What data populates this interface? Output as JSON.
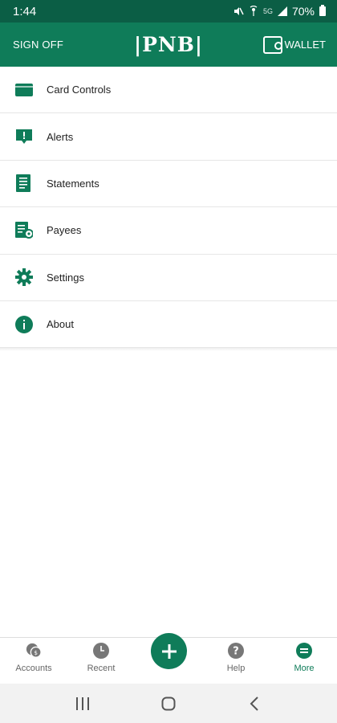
{
  "status_bar": {
    "time": "1:44",
    "network": "5G",
    "battery": "70%"
  },
  "header": {
    "sign_off": "SIGN OFF",
    "logo": "|PNB|",
    "wallet": "WALLET"
  },
  "menu": {
    "items": [
      {
        "label": "Card Controls",
        "icon": "card-icon"
      },
      {
        "label": "Alerts",
        "icon": "alert-icon"
      },
      {
        "label": "Statements",
        "icon": "statement-icon"
      },
      {
        "label": "Payees",
        "icon": "payees-icon"
      },
      {
        "label": "Settings",
        "icon": "gear-icon"
      },
      {
        "label": "About",
        "icon": "info-icon"
      }
    ]
  },
  "bottom_nav": {
    "items": [
      {
        "label": "Accounts",
        "icon": "accounts-icon"
      },
      {
        "label": "Recent",
        "icon": "clock-icon"
      },
      {
        "label": "Help",
        "icon": "help-icon"
      },
      {
        "label": "More",
        "icon": "more-icon",
        "active": true
      }
    ],
    "fab_icon": "plus-icon"
  },
  "colors": {
    "primary": "#0f7c59",
    "status_bar": "#0b5e45",
    "inactive": "#666666"
  }
}
